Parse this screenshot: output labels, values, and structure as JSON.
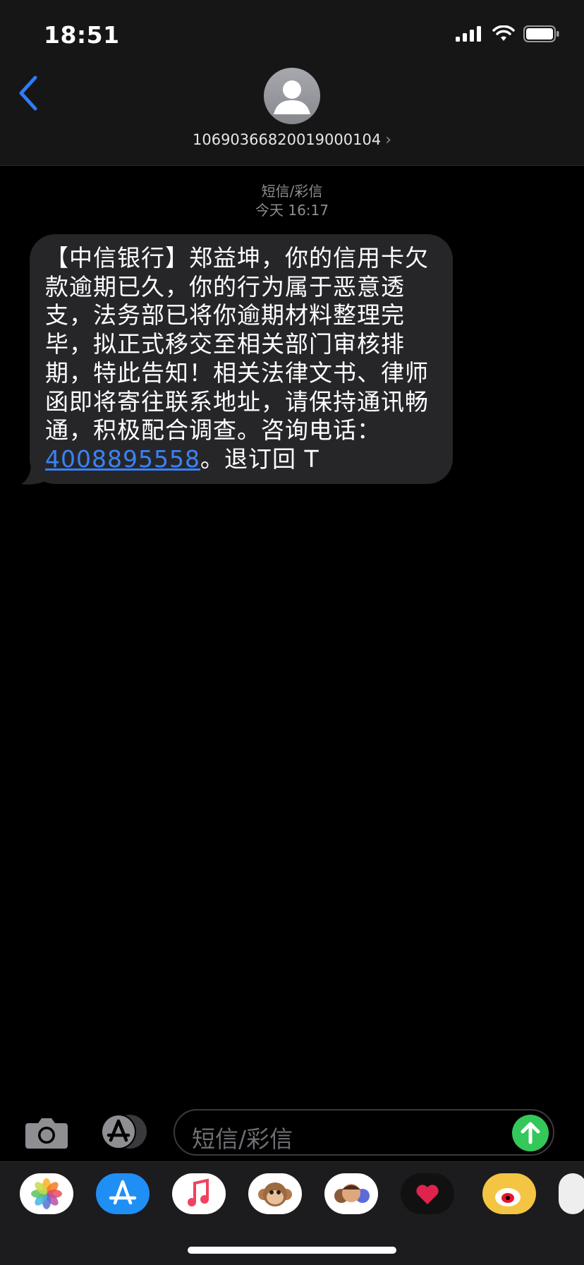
{
  "status_bar": {
    "time": "18:51"
  },
  "header": {
    "contact": "10690366820019000104",
    "chevron": "›"
  },
  "thread": {
    "service": "短信/彩信",
    "timestamp": "今天 16:17"
  },
  "message": {
    "text_lines": [
      "【中信银行】郑益坤，你的信用卡欠",
      "款逾期已久，你的行为属于恶意透",
      "支，法务部已将你逾期材料整理完",
      "毕，拟正式移交至相关部门审核排",
      "期，特此告知！相关法律文书、律师",
      "函即将寄往联系地址，请保持通讯畅",
      "通，积极配合调查。咨询电话："
    ],
    "phone": "4008895558",
    "suffix": "。退订回 T"
  },
  "composer": {
    "placeholder": "短信/彩信"
  },
  "app_drawer": {
    "apps": [
      "photos",
      "app-store",
      "music",
      "animoji",
      "memoji",
      "digital-touch",
      "weibo",
      "more"
    ]
  },
  "colors": {
    "link": "#3b82f6",
    "send": "#34c759",
    "bubble": "#262629"
  }
}
